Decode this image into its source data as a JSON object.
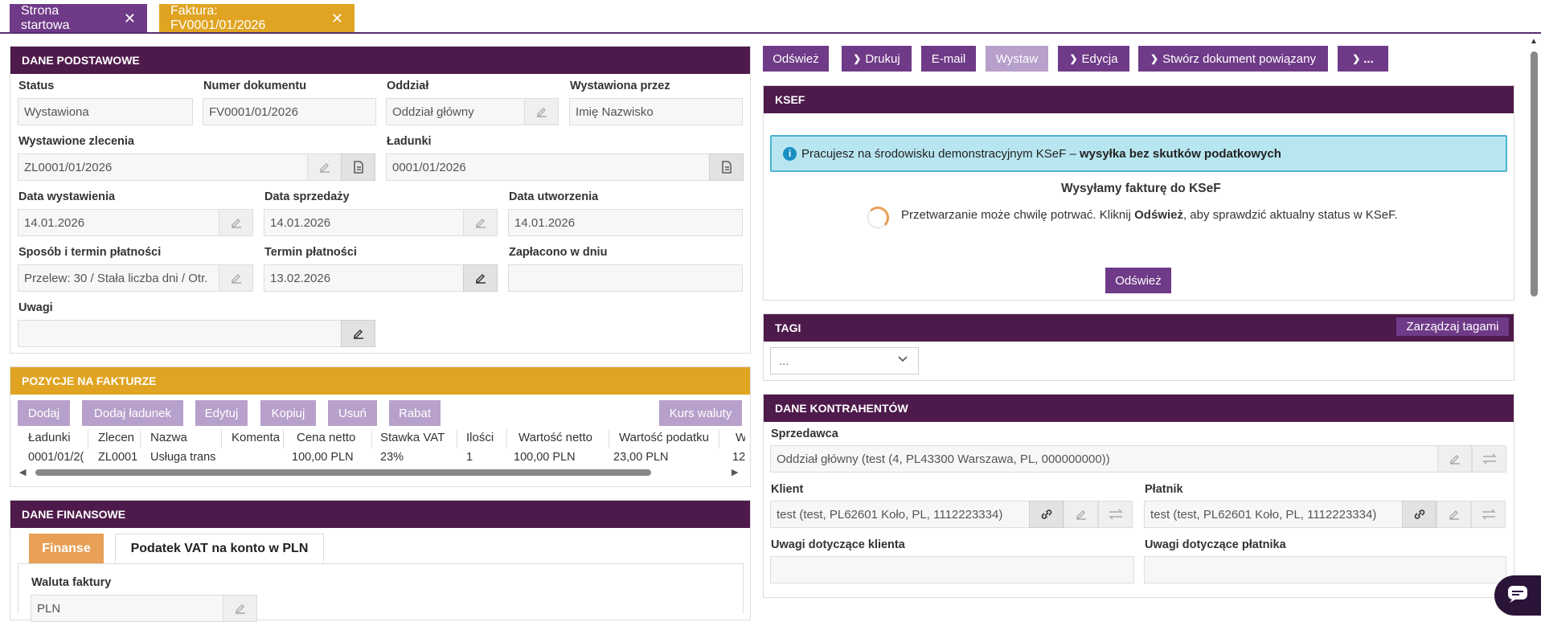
{
  "tabs": [
    {
      "label": "Strona startowa"
    },
    {
      "label": "Faktura: FV0001/01/2026"
    }
  ],
  "basic": {
    "header": "DANE PODSTAWOWE",
    "status_label": "Status",
    "status_value": "Wystawiona",
    "number_label": "Numer dokumentu",
    "number_value": "FV0001/01/2026",
    "branch_label": "Oddział",
    "branch_value": "Oddział główny",
    "issued_by_label": "Wystawiona przez",
    "issued_by_value": "Imię Nazwisko",
    "orders_label": "Wystawione zlecenia",
    "orders_value": "ZL0001/01/2026",
    "loads_label": "Ładunki",
    "loads_value": "0001/01/2026",
    "issue_date_label": "Data wystawienia",
    "issue_date_value": "14.01.2026",
    "sale_date_label": "Data sprzedaży",
    "sale_date_value": "14.01.2026",
    "created_date_label": "Data utworzenia",
    "created_date_value": "14.01.2026",
    "payment_method_label": "Sposób i termin płatności",
    "payment_method_value": "Przelew: 30 / Stała liczba dni / Otr.",
    "payment_due_label": "Termin płatności",
    "payment_due_value": "13.02.2026",
    "paid_on_label": "Zapłacono w dniu",
    "paid_on_value": "",
    "notes_label": "Uwagi",
    "notes_value": ""
  },
  "toolbar": {
    "refresh": "Odśwież",
    "print": "Drukuj",
    "email": "E-mail",
    "issue": "Wystaw",
    "edit": "Edycja",
    "create_related": "Stwórz dokument powiązany",
    "more": "..."
  },
  "items": {
    "header": "POZYCJE NA FAKTURZE",
    "buttons": [
      "Dodaj",
      "Dodaj ładunek",
      "Edytuj",
      "Kopiuj",
      "Usuń",
      "Rabat"
    ],
    "currency_rate": "Kurs waluty",
    "columns": [
      "Ładunki",
      "Zlecen",
      "Nazwa",
      "Komenta",
      "Cena netto",
      "Stawka VAT",
      "Ilości",
      "Wartość netto",
      "Wartość podatku",
      "W"
    ],
    "rows": [
      [
        "0001/01/2(",
        "ZL0001.",
        "Usługa trans",
        "",
        "100,00 PLN",
        "23%",
        "1",
        "100,00 PLN",
        "23,00 PLN",
        "12"
      ]
    ]
  },
  "finance": {
    "header": "DANE FINANSOWE",
    "tab_finance": "Finanse",
    "tab_vat": "Podatek VAT na konto w PLN",
    "currency_label": "Waluta faktury",
    "currency_value": "PLN"
  },
  "ksef": {
    "header": "KSEF",
    "info_text": "Pracujesz na środowisku demonstracyjnym KSeF – ",
    "info_bold": "wysyłka bez skutków podatkowych",
    "title": "Wysyłamy fakturę do KSeF",
    "msg_a": "Przetwarzanie może chwilę potrwać. Kliknij ",
    "msg_b": "Odśwież",
    "msg_c": ", aby sprawdzić aktualny status w KSeF.",
    "refresh": "Odśwież"
  },
  "tags": {
    "header": "TAGI",
    "manage": "Zarządzaj tagami",
    "select_value": "..."
  },
  "parties": {
    "header": "DANE KONTRAHENTÓW",
    "seller_label": "Sprzedawca",
    "seller_value": "Oddział główny (test (4, PL43300 Warszawa, PL, 000000000))",
    "client_label": "Klient",
    "client_value": "test (test, PL62601 Koło, PL, 1112223334)",
    "payer_label": "Płatnik",
    "payer_value": "test (test, PL62601 Koło, PL, 1112223334)",
    "client_notes_label": "Uwagi dotyczące klienta",
    "payer_notes_label": "Uwagi dotyczące płatnika"
  },
  "colors": {
    "primary": "#6f3a87",
    "dark": "#4e1a4b",
    "gold": "#e0a422",
    "info": "#b8e6f0"
  }
}
